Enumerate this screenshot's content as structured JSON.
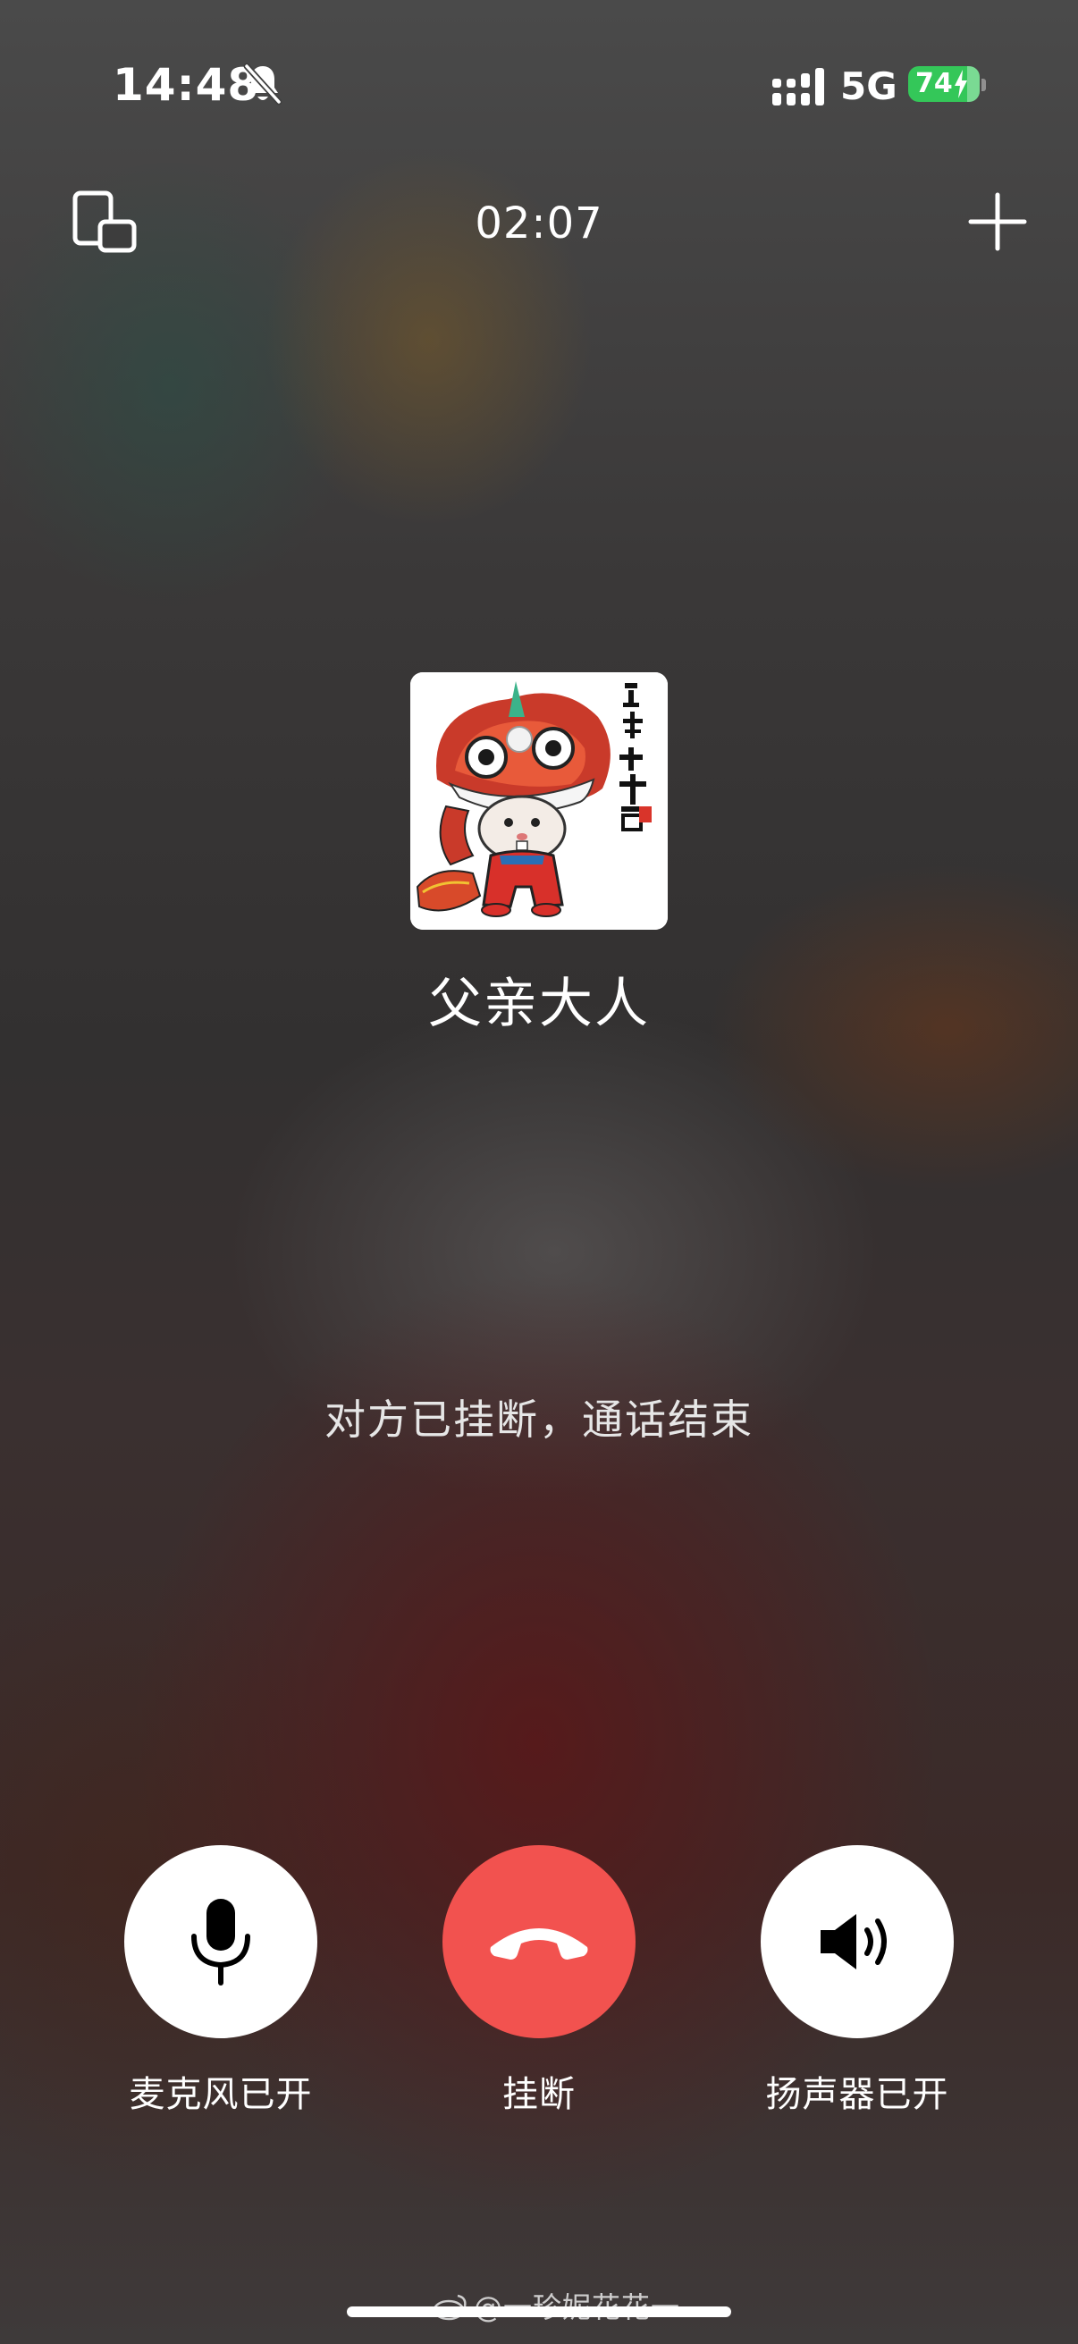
{
  "status_bar": {
    "time": "14:48",
    "network": "5G",
    "battery": "74",
    "icons": [
      "bell-off-icon",
      "signal-icon",
      "battery-icon",
      "bolt-icon"
    ]
  },
  "call": {
    "timer": "02:07",
    "contact_name": "父亲大人",
    "status": "对方已挂断，通话结束",
    "avatar_text": "白鼠年大吉"
  },
  "controls": {
    "mic": {
      "label": "麦克风已开",
      "icon": "microphone-icon"
    },
    "hangup": {
      "label": "挂断",
      "icon": "phone-hangup-icon"
    },
    "speaker": {
      "label": "扬声器已开",
      "icon": "speaker-icon"
    }
  },
  "watermark": {
    "text": "@一珍妮花花一"
  },
  "colors": {
    "hangup": "#f2524f",
    "battery": "#34c759",
    "button_bg": "#ffffff"
  }
}
